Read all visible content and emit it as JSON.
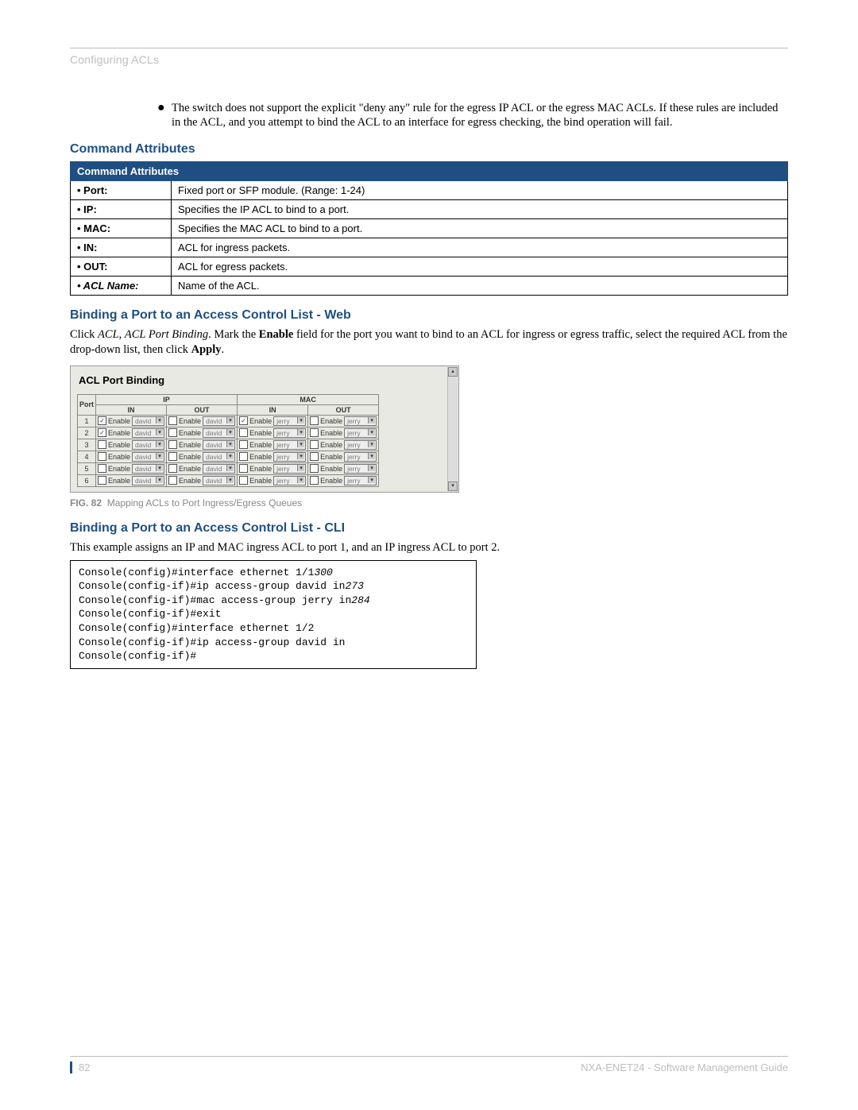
{
  "header": {
    "chapter": "Configuring ACLs"
  },
  "intro_bullet": "The switch does not support the explicit \"deny any\" rule for the egress IP ACL or the egress MAC ACLs. If these rules are included in the ACL, and you attempt to bind the ACL to an interface for egress checking, the bind operation will fail.",
  "sections": {
    "cmd_attrs_heading": "Command Attributes",
    "table_header": "Command Attributes",
    "rows": [
      {
        "k": "• Port:",
        "v": "Fixed port or SFP module. (Range: 1-24)"
      },
      {
        "k": "• IP:",
        "v": "Specifies the IP ACL to bind to a port."
      },
      {
        "k": "• MAC:",
        "v": "Specifies the MAC ACL to bind to a port."
      },
      {
        "k": "• IN:",
        "v": "ACL for ingress packets."
      },
      {
        "k": "• OUT:",
        "v": "ACL for egress packets."
      },
      {
        "k": "• ACL Name:",
        "v": "Name of the ACL.",
        "italic": true
      }
    ],
    "web_heading": "Binding a Port to an Access Control List - Web",
    "web_para_pre": "Click ",
    "web_para_em1": "ACL",
    "web_para_mid1": ", ",
    "web_para_em2": "ACL Port Binding",
    "web_para_mid2": ". Mark the ",
    "web_para_b1": "Enable",
    "web_para_mid3": " field for the port you want to bind to an ACL for ingress or egress traffic, select the required ACL from the drop-down list, then click ",
    "web_para_b2": "Apply",
    "web_para_end": ".",
    "fig_num": "FIG. 82",
    "fig_cap": "Mapping ACLs to Port Ingress/Egress Queues",
    "cli_heading": "Binding a Port to an Access Control List - CLI",
    "cli_para": "This example assigns an IP and MAC ingress ACL to port 1, and an IP ingress ACL to port 2."
  },
  "screenshot": {
    "title": "ACL Port Binding",
    "col_port": "Port",
    "col_ip": "IP",
    "col_mac": "MAC",
    "col_in": "IN",
    "col_out": "OUT",
    "enable": "Enable",
    "acl_ip": "david",
    "acl_mac": "jerry",
    "rows": [
      {
        "p": "1",
        "ip_in": true,
        "ip_out": false,
        "mac_in": true,
        "mac_out": false
      },
      {
        "p": "2",
        "ip_in": true,
        "ip_out": false,
        "mac_in": false,
        "mac_out": false
      },
      {
        "p": "3",
        "ip_in": false,
        "ip_out": false,
        "mac_in": false,
        "mac_out": false
      },
      {
        "p": "4",
        "ip_in": false,
        "ip_out": false,
        "mac_in": false,
        "mac_out": false
      },
      {
        "p": "5",
        "ip_in": false,
        "ip_out": false,
        "mac_in": false,
        "mac_out": false
      },
      {
        "p": "6",
        "ip_in": false,
        "ip_out": false,
        "mac_in": false,
        "mac_out": false
      }
    ]
  },
  "cli": {
    "l1a": "Console(config)#interface ethernet 1/1",
    "l1b": "300",
    "l2a": "Console(config-if)#ip access-group david in",
    "l2b": "273",
    "l3a": "Console(config-if)#mac access-group jerry in",
    "l3b": "284",
    "l4": "Console(config-if)#exit",
    "l5": "Console(config)#interface ethernet 1/2",
    "l6": "Console(config-if)#ip access-group david in",
    "l7": "Console(config-if)#"
  },
  "footer": {
    "page": "82",
    "doc": "NXA-ENET24 - Software Management Guide"
  }
}
